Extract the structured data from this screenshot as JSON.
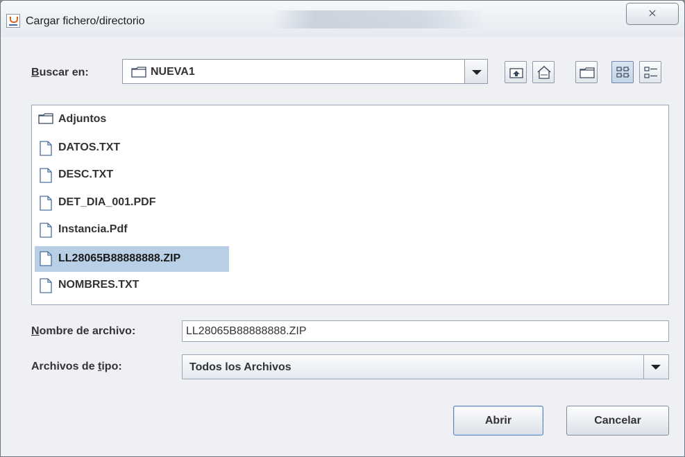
{
  "window": {
    "title": "Cargar fichero/directorio",
    "close_glyph": "⨯"
  },
  "look_in": {
    "label_prefix": "B",
    "label_rest": "uscar en:",
    "current_folder": "NUEVA1"
  },
  "toolbar": {
    "buttons": [
      {
        "icon": "up-one-level-icon"
      },
      {
        "icon": "home-icon"
      },
      {
        "icon": "new-folder-icon"
      },
      {
        "icon": "list-view-icon",
        "pressed": true
      },
      {
        "icon": "details-view-icon"
      }
    ]
  },
  "files": [
    {
      "name": "Adjuntos",
      "type": "folder"
    },
    {
      "name": "DATOS.TXT",
      "type": "file"
    },
    {
      "name": "DESC.TXT",
      "type": "file"
    },
    {
      "name": "DET_DIA_001.PDF",
      "type": "file"
    },
    {
      "name": "Instancia.Pdf",
      "type": "file"
    },
    {
      "name": "LL28065B88888888.ZIP",
      "type": "file",
      "selected": true
    },
    {
      "name": "NOMBRES.TXT",
      "type": "file"
    }
  ],
  "file_name": {
    "label_prefix": "N",
    "label_rest": "ombre de archivo:",
    "value": "LL28065B88888888.ZIP"
  },
  "file_type": {
    "label_before": "Archivos de ",
    "label_underlined": "t",
    "label_after": "ipo:",
    "selected": "Todos los Archivos"
  },
  "buttons": {
    "open": "Abrir",
    "cancel": "Cancelar"
  },
  "colors": {
    "selection": "#b8cfe5",
    "window_bg": "#eef0f4",
    "border": "#9aa6b5"
  }
}
